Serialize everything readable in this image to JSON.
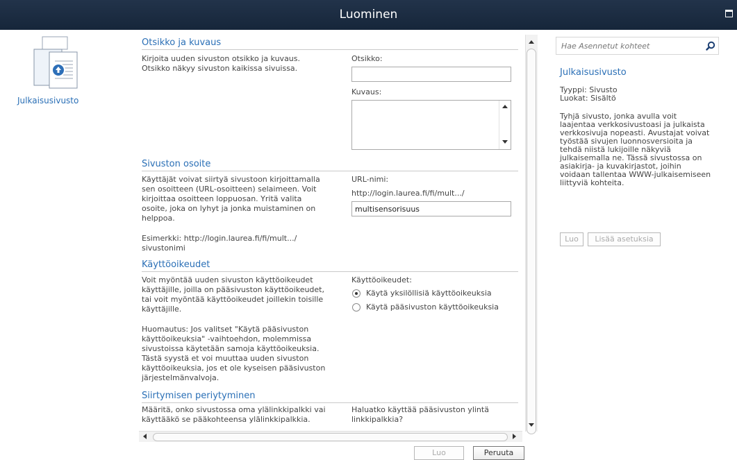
{
  "window": {
    "title": "Luominen"
  },
  "left": {
    "template_label": "Julkaisusivusto"
  },
  "sections": {
    "title_desc": {
      "heading": "Otsikko ja kuvaus",
      "desc": [
        "Kirjoita uuden sivuston otsikko ja kuvaus.",
        "Otsikko näkyy sivuston kaikissa sivuissa."
      ],
      "title_label": "Otsikko:",
      "title_value": "",
      "desc_label": "Kuvaus:"
    },
    "address": {
      "heading": "Sivuston osoite",
      "desc": [
        "Käyttäjät voivat siirtyä sivustoon kirjoittamalla",
        "sen osoitteen (URL-osoitteen) selaimeen. Voit",
        "kirjoittaa osoitteen loppuosan. Yritä valita",
        "osoite, joka on lyhyt ja jonka muistaminen on",
        "helppoa."
      ],
      "example": [
        "Esimerkki: http://login.laurea.fi/fi/mult.../",
        "sivustonimi"
      ],
      "url_label": "URL-nimi:",
      "url_prefix": "http://login.laurea.fi/fi/mult.../",
      "url_value": "multisensorisuus"
    },
    "permissions": {
      "heading": "Käyttöoikeudet",
      "desc": [
        "Voit myöntää uuden sivuston käyttöoikeudet",
        "käyttäjille, joilla on pääsivuston käyttöoikeudet,",
        "tai voit myöntää käyttöoikeudet joillekin toisille",
        "käyttäjille."
      ],
      "note": [
        "Huomautus: Jos valitset \"Käytä pääsivuston",
        "käyttöoikeuksia\" -vaihtoehdon, molemmissa",
        "sivustoissa käytetään samoja käyttöoikeuksia.",
        "Tästä syystä et voi muuttaa uuden sivuston",
        "käyttöoikeuksia, jos et ole kyseisen pääsivuston",
        "järjestelmänvalvoja."
      ],
      "label": "Käyttöoikeudet:",
      "options": [
        {
          "label": "Käytä yksilöllisiä käyttöoikeuksia",
          "selected": true
        },
        {
          "label": "Käytä pääsivuston käyttöoikeuksia",
          "selected": false
        }
      ]
    },
    "navigation": {
      "heading": "Siirtymisen periytyminen",
      "desc": [
        "Määritä, onko sivustossa oma ylälinkkipalkki vai",
        "käyttääkö se pääkohteensa ylälinkkipalkkia."
      ],
      "question": [
        "Haluatko käyttää pääsivuston ylintä",
        "linkkipalkkia?"
      ]
    }
  },
  "footer": {
    "create_label": "Luo",
    "cancel_label": "Peruuta"
  },
  "right_panel": {
    "search_placeholder": "Hae Asennetut kohteet",
    "title": "Julkaisusivusto",
    "type": "Tyyppi: Sivusto",
    "categories": "Luokat: Sisältö",
    "description": [
      "Tyhjä sivusto, jonka avulla voit",
      "laajentaa verkkosivustoasi ja julkaista",
      "verkkosivuja nopeasti. Avustajat voivat",
      "työstää sivujen luonnosversioita ja",
      "tehdä niistä lukijoille näkyviä",
      "julkaisemalla ne. Tässä sivustossa on",
      "asiakirja- ja kuvakirjastot, joihin",
      "voidaan tallentaa WWW-julkaisemiseen",
      "liittyviä kohteita."
    ],
    "create_label": "Luo",
    "more_options_label": "Lisää asetuksia"
  },
  "colors": {
    "titlebar": "#1c2c42",
    "link": "#2a6fb6",
    "text": "#444444"
  },
  "icons": [
    "maximize-icon",
    "site-template-icon",
    "search-icon",
    "scroll-up-icon",
    "scroll-down-icon",
    "scroll-left-icon",
    "scroll-right-icon"
  ]
}
